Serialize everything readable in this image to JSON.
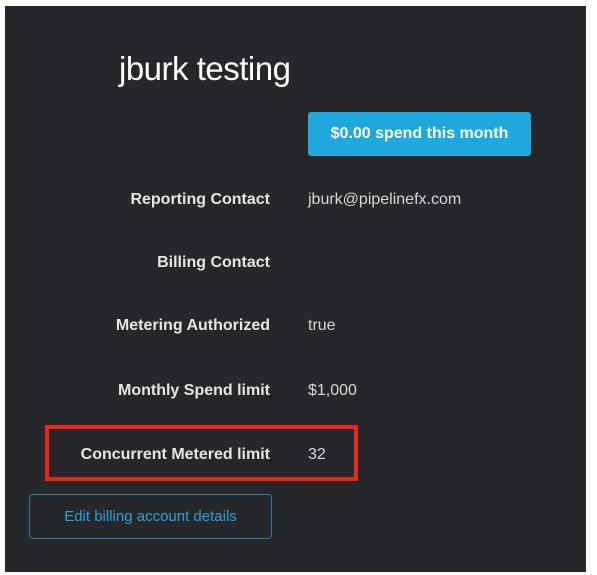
{
  "account": {
    "title": "jburk testing",
    "spend_badge": "$0.00 spend this month"
  },
  "details": [
    {
      "label": "Reporting Contact",
      "value": "jburk@pipelinefx.com"
    },
    {
      "label": "Billing Contact",
      "value": ""
    },
    {
      "label": "Metering Authorized",
      "value": "true"
    },
    {
      "label": "Monthly Spend limit",
      "value": "$1,000"
    },
    {
      "label": "Concurrent Metered limit",
      "value": "32"
    }
  ],
  "actions": {
    "edit_label": "Edit billing account details"
  },
  "colors": {
    "panel_background": "#25272b",
    "accent": "#1ea8de",
    "highlight": "#e8261a"
  }
}
